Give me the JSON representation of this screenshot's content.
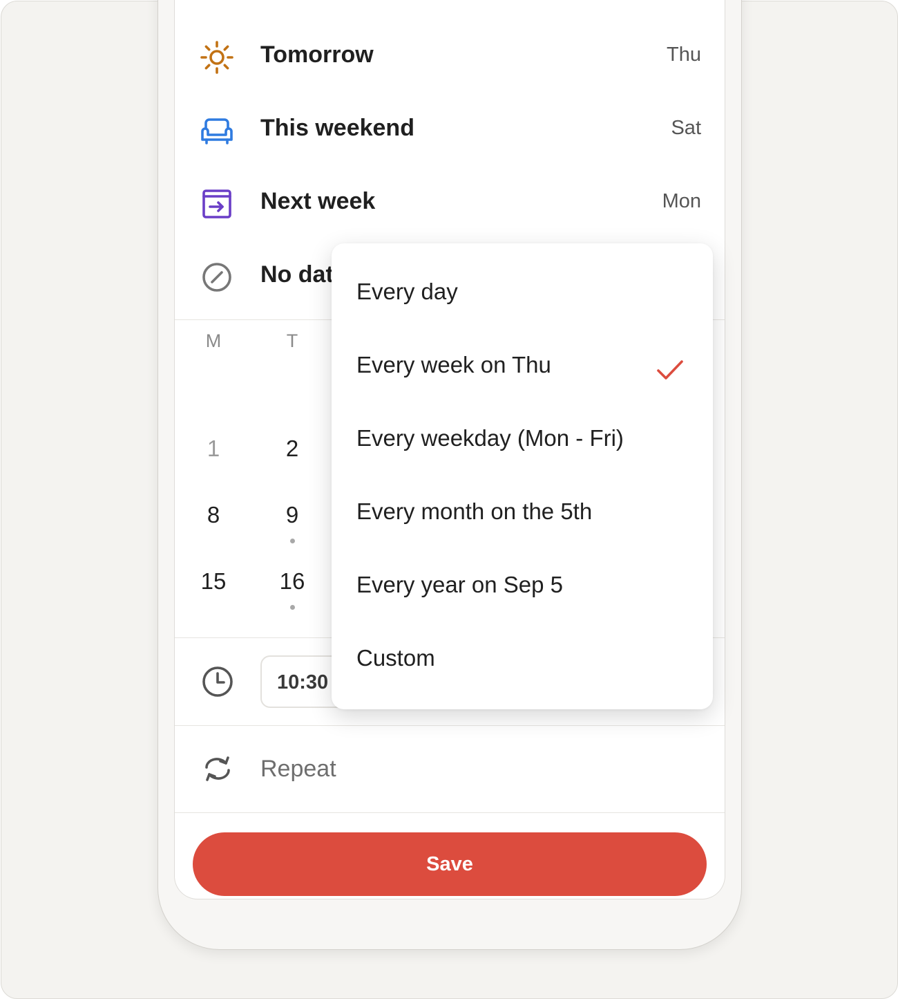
{
  "quick_dates": [
    {
      "label": "Tomorrow",
      "day": "Thu",
      "icon": "sun-icon",
      "color": "#c27214"
    },
    {
      "label": "This weekend",
      "day": "Sat",
      "icon": "sofa-icon",
      "color": "#2f7be0"
    },
    {
      "label": "Next week",
      "day": "Mon",
      "icon": "next-week-icon",
      "color": "#6a3ec7"
    },
    {
      "label": "No dat",
      "icon": "no-date-icon",
      "color": "#777777"
    }
  ],
  "calendar": {
    "weekday_headers": [
      "M",
      "T"
    ],
    "rows": [
      [
        "1",
        "2"
      ],
      [
        "8",
        "9"
      ],
      [
        "15",
        "16"
      ]
    ]
  },
  "time": {
    "value": "10:30",
    "icon": "clock-icon"
  },
  "repeat": {
    "label": "Repeat",
    "icon": "repeat-icon"
  },
  "save_label": "Save",
  "repeat_menu": {
    "items": [
      {
        "label": "Every day",
        "selected": false
      },
      {
        "label": "Every week on Thu",
        "selected": true
      },
      {
        "label": "Every weekday (Mon - Fri)",
        "selected": false
      },
      {
        "label": "Every month on the 5th",
        "selected": false
      },
      {
        "label": "Every year on Sep 5",
        "selected": false
      },
      {
        "label": "Custom",
        "selected": false
      }
    ],
    "check_color": "#dc4c3e"
  },
  "colors": {
    "accent": "#dc4c3e",
    "background": "#f4f3f0"
  }
}
